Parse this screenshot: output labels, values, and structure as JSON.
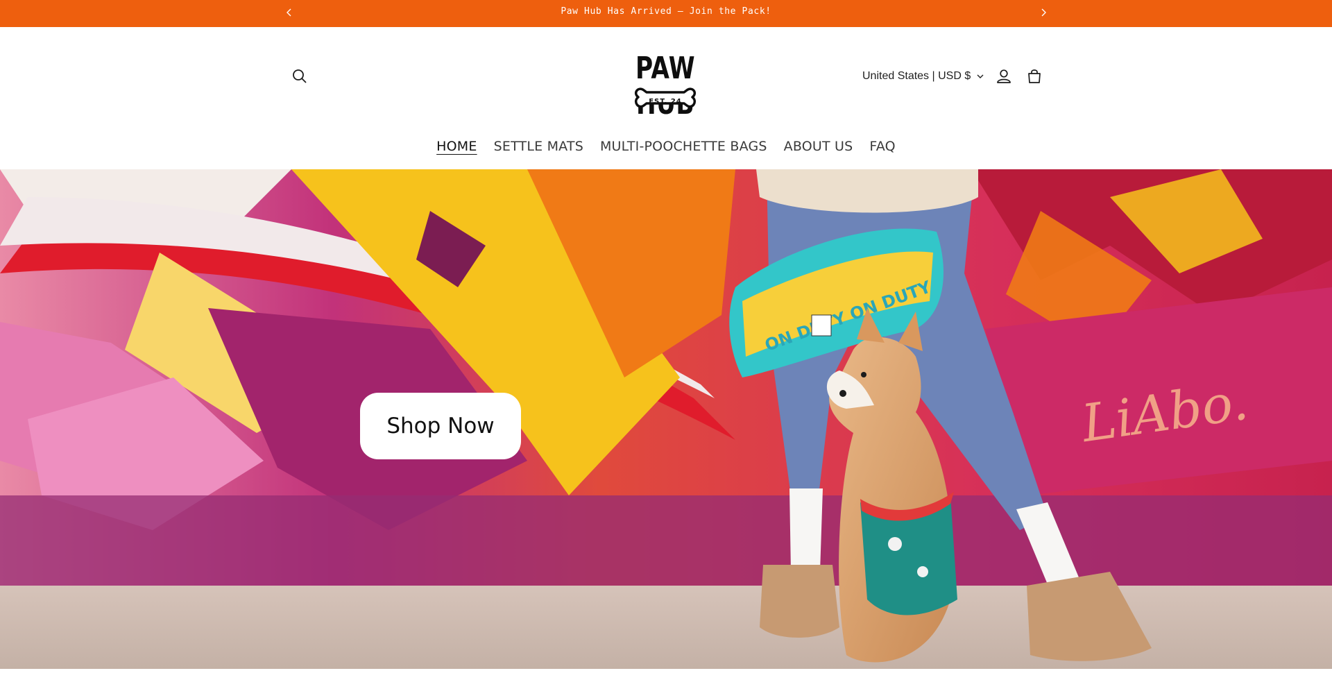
{
  "announcement": {
    "text": "Paw Hub Has Arrived — Join the Pack!",
    "prev_icon": "chevron-left-icon",
    "next_icon": "chevron-right-icon"
  },
  "header": {
    "logo": {
      "wordmark": "PAW HUB",
      "badge": "EST. 24"
    },
    "locale_label": "United States | USD $",
    "icons": {
      "search": "search-icon",
      "account": "account-icon",
      "cart": "cart-icon"
    }
  },
  "nav": {
    "items": [
      {
        "label": "HOME",
        "active": true
      },
      {
        "label": "SETTLE MATS",
        "active": false
      },
      {
        "label": "MULTI-POOCHETTE BAGS",
        "active": false
      },
      {
        "label": "ABOUT US",
        "active": false
      },
      {
        "label": "FAQ",
        "active": false
      }
    ]
  },
  "hero": {
    "cta_label": "Shop Now",
    "graffiti_tag": "LiAbo.",
    "bag_print": "ON DUTY ON DUTY"
  },
  "colors": {
    "announcement_bg": "#ee5f0e",
    "text": "#121212",
    "mural_magenta": "#c62a6a",
    "mural_orange": "#f07a16",
    "mural_yellow": "#f6c21c"
  }
}
